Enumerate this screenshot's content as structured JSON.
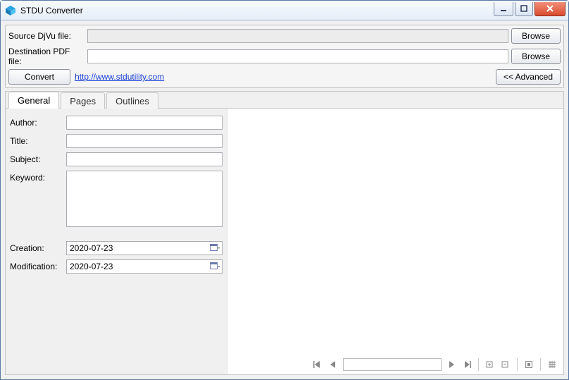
{
  "window": {
    "title": "STDU Converter"
  },
  "top": {
    "source_label": "Source DjVu file:",
    "dest_label": "Destination PDF file:",
    "source_value": "",
    "dest_value": "",
    "browse_label": "Browse",
    "convert_label": "Convert",
    "link_text": "http://www.stdutility.com",
    "advanced_label": "<< Advanced"
  },
  "tabs": {
    "general": "General",
    "pages": "Pages",
    "outlines": "Outlines"
  },
  "meta": {
    "author_label": "Author:",
    "title_label": "Title:",
    "subject_label": "Subject:",
    "keyword_label": "Keyword:",
    "creation_label": "Creation:",
    "modification_label": "Modification:",
    "author": "",
    "title": "",
    "subject": "",
    "keyword": "",
    "creation": "2020-07-23",
    "modification": "2020-07-23"
  },
  "nav": {
    "page_value": ""
  }
}
